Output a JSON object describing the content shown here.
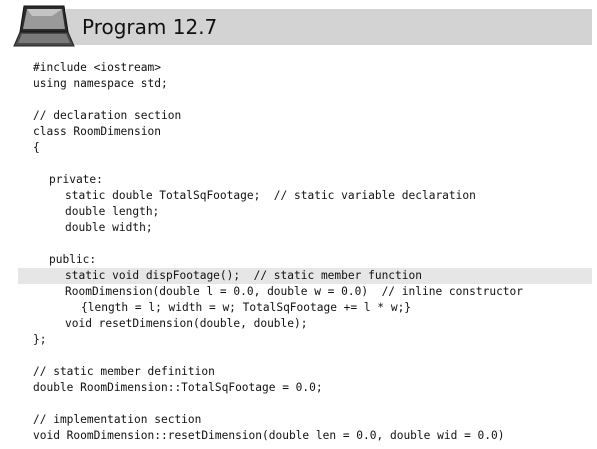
{
  "header": {
    "title": "Program 12.7"
  },
  "code": {
    "lines": [
      {
        "text": "#include <iostream>",
        "indent": 0,
        "highlight": false
      },
      {
        "text": "using namespace std;",
        "indent": 0,
        "highlight": false
      },
      {
        "text": "",
        "indent": 0,
        "highlight": false
      },
      {
        "text": "// declaration section",
        "indent": 0,
        "highlight": false
      },
      {
        "text": "class RoomDimension",
        "indent": 0,
        "highlight": false
      },
      {
        "text": "{",
        "indent": 0,
        "highlight": false
      },
      {
        "text": "",
        "indent": 0,
        "highlight": false
      },
      {
        "text": "private:",
        "indent": 1,
        "highlight": false
      },
      {
        "text": "static double TotalSqFootage;  // static variable declaration",
        "indent": 2,
        "highlight": false
      },
      {
        "text": "double length;",
        "indent": 2,
        "highlight": false
      },
      {
        "text": "double width;",
        "indent": 2,
        "highlight": false
      },
      {
        "text": "",
        "indent": 0,
        "highlight": false
      },
      {
        "text": "public:",
        "indent": 1,
        "highlight": false
      },
      {
        "text": "static void dispFootage();  // static member function",
        "indent": 2,
        "highlight": true
      },
      {
        "text": "RoomDimension(double l = 0.0, double w = 0.0)  // inline constructor",
        "indent": 2,
        "highlight": false
      },
      {
        "text": "{length = l; width = w; TotalSqFootage += l * w;}",
        "indent": 3,
        "highlight": false
      },
      {
        "text": "void resetDimension(double, double);",
        "indent": 2,
        "highlight": false
      },
      {
        "text": "};",
        "indent": 0,
        "highlight": false
      },
      {
        "text": "",
        "indent": 0,
        "highlight": false
      },
      {
        "text": "// static member definition",
        "indent": 0,
        "highlight": false
      },
      {
        "text": "double RoomDimension::TotalSqFootage = 0.0;",
        "indent": 0,
        "highlight": false
      },
      {
        "text": "",
        "indent": 0,
        "highlight": false
      },
      {
        "text": "// implementation section",
        "indent": 0,
        "highlight": false
      },
      {
        "text": "void RoomDimension::resetDimension(double len = 0.0, double wid = 0.0)",
        "indent": 0,
        "highlight": false
      }
    ]
  }
}
